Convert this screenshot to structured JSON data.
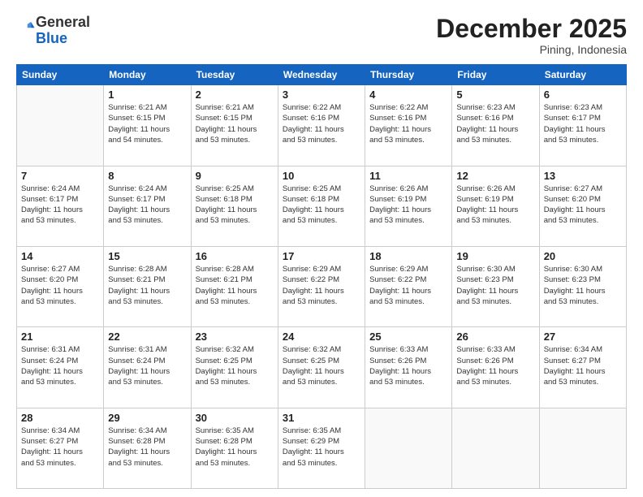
{
  "header": {
    "logo_general": "General",
    "logo_blue": "Blue",
    "month": "December 2025",
    "location": "Pining, Indonesia"
  },
  "days_of_week": [
    "Sunday",
    "Monday",
    "Tuesday",
    "Wednesday",
    "Thursday",
    "Friday",
    "Saturday"
  ],
  "weeks": [
    [
      {
        "day": "",
        "info": ""
      },
      {
        "day": "1",
        "info": "Sunrise: 6:21 AM\nSunset: 6:15 PM\nDaylight: 11 hours\nand 54 minutes."
      },
      {
        "day": "2",
        "info": "Sunrise: 6:21 AM\nSunset: 6:15 PM\nDaylight: 11 hours\nand 53 minutes."
      },
      {
        "day": "3",
        "info": "Sunrise: 6:22 AM\nSunset: 6:16 PM\nDaylight: 11 hours\nand 53 minutes."
      },
      {
        "day": "4",
        "info": "Sunrise: 6:22 AM\nSunset: 6:16 PM\nDaylight: 11 hours\nand 53 minutes."
      },
      {
        "day": "5",
        "info": "Sunrise: 6:23 AM\nSunset: 6:16 PM\nDaylight: 11 hours\nand 53 minutes."
      },
      {
        "day": "6",
        "info": "Sunrise: 6:23 AM\nSunset: 6:17 PM\nDaylight: 11 hours\nand 53 minutes."
      }
    ],
    [
      {
        "day": "7",
        "info": "Sunrise: 6:24 AM\nSunset: 6:17 PM\nDaylight: 11 hours\nand 53 minutes."
      },
      {
        "day": "8",
        "info": "Sunrise: 6:24 AM\nSunset: 6:17 PM\nDaylight: 11 hours\nand 53 minutes."
      },
      {
        "day": "9",
        "info": "Sunrise: 6:25 AM\nSunset: 6:18 PM\nDaylight: 11 hours\nand 53 minutes."
      },
      {
        "day": "10",
        "info": "Sunrise: 6:25 AM\nSunset: 6:18 PM\nDaylight: 11 hours\nand 53 minutes."
      },
      {
        "day": "11",
        "info": "Sunrise: 6:26 AM\nSunset: 6:19 PM\nDaylight: 11 hours\nand 53 minutes."
      },
      {
        "day": "12",
        "info": "Sunrise: 6:26 AM\nSunset: 6:19 PM\nDaylight: 11 hours\nand 53 minutes."
      },
      {
        "day": "13",
        "info": "Sunrise: 6:27 AM\nSunset: 6:20 PM\nDaylight: 11 hours\nand 53 minutes."
      }
    ],
    [
      {
        "day": "14",
        "info": "Sunrise: 6:27 AM\nSunset: 6:20 PM\nDaylight: 11 hours\nand 53 minutes."
      },
      {
        "day": "15",
        "info": "Sunrise: 6:28 AM\nSunset: 6:21 PM\nDaylight: 11 hours\nand 53 minutes."
      },
      {
        "day": "16",
        "info": "Sunrise: 6:28 AM\nSunset: 6:21 PM\nDaylight: 11 hours\nand 53 minutes."
      },
      {
        "day": "17",
        "info": "Sunrise: 6:29 AM\nSunset: 6:22 PM\nDaylight: 11 hours\nand 53 minutes."
      },
      {
        "day": "18",
        "info": "Sunrise: 6:29 AM\nSunset: 6:22 PM\nDaylight: 11 hours\nand 53 minutes."
      },
      {
        "day": "19",
        "info": "Sunrise: 6:30 AM\nSunset: 6:23 PM\nDaylight: 11 hours\nand 53 minutes."
      },
      {
        "day": "20",
        "info": "Sunrise: 6:30 AM\nSunset: 6:23 PM\nDaylight: 11 hours\nand 53 minutes."
      }
    ],
    [
      {
        "day": "21",
        "info": "Sunrise: 6:31 AM\nSunset: 6:24 PM\nDaylight: 11 hours\nand 53 minutes."
      },
      {
        "day": "22",
        "info": "Sunrise: 6:31 AM\nSunset: 6:24 PM\nDaylight: 11 hours\nand 53 minutes."
      },
      {
        "day": "23",
        "info": "Sunrise: 6:32 AM\nSunset: 6:25 PM\nDaylight: 11 hours\nand 53 minutes."
      },
      {
        "day": "24",
        "info": "Sunrise: 6:32 AM\nSunset: 6:25 PM\nDaylight: 11 hours\nand 53 minutes."
      },
      {
        "day": "25",
        "info": "Sunrise: 6:33 AM\nSunset: 6:26 PM\nDaylight: 11 hours\nand 53 minutes."
      },
      {
        "day": "26",
        "info": "Sunrise: 6:33 AM\nSunset: 6:26 PM\nDaylight: 11 hours\nand 53 minutes."
      },
      {
        "day": "27",
        "info": "Sunrise: 6:34 AM\nSunset: 6:27 PM\nDaylight: 11 hours\nand 53 minutes."
      }
    ],
    [
      {
        "day": "28",
        "info": "Sunrise: 6:34 AM\nSunset: 6:27 PM\nDaylight: 11 hours\nand 53 minutes."
      },
      {
        "day": "29",
        "info": "Sunrise: 6:34 AM\nSunset: 6:28 PM\nDaylight: 11 hours\nand 53 minutes."
      },
      {
        "day": "30",
        "info": "Sunrise: 6:35 AM\nSunset: 6:28 PM\nDaylight: 11 hours\nand 53 minutes."
      },
      {
        "day": "31",
        "info": "Sunrise: 6:35 AM\nSunset: 6:29 PM\nDaylight: 11 hours\nand 53 minutes."
      },
      {
        "day": "",
        "info": ""
      },
      {
        "day": "",
        "info": ""
      },
      {
        "day": "",
        "info": ""
      }
    ]
  ]
}
